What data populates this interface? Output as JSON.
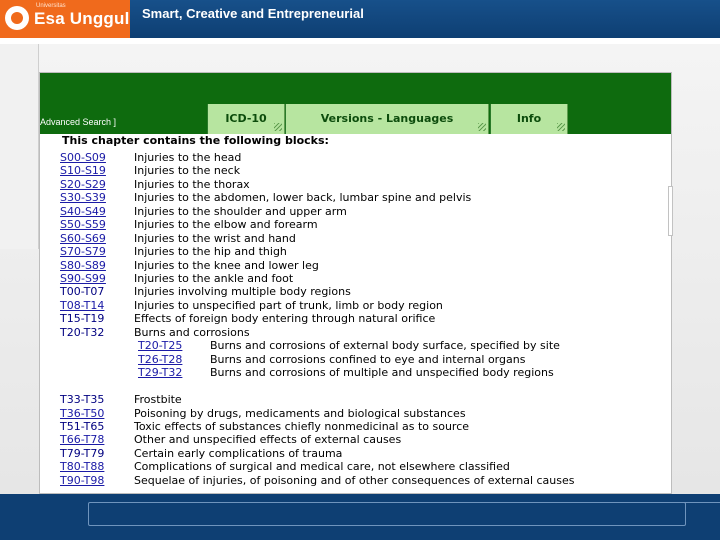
{
  "slide": {
    "logo_university_label": "Universitas",
    "logo_name": "Esa Unggul",
    "tagline": "Smart, Creative and Entrepreneurial"
  },
  "browser": {
    "advanced_search_label": "Advanced Search ]",
    "tabs": [
      {
        "label": "ICD-10"
      },
      {
        "label": "Versions - Languages"
      },
      {
        "label": "Info"
      }
    ]
  },
  "chapter": {
    "intro": "This chapter contains the following blocks:",
    "blocks": [
      {
        "code": "S00-S09",
        "title": "Injuries to the head",
        "link": true
      },
      {
        "code": "S10-S19",
        "title": "Injuries to the neck",
        "link": true
      },
      {
        "code": "S20-S29",
        "title": "Injuries to the thorax",
        "link": true
      },
      {
        "code": "S30-S39",
        "title": "Injuries to the abdomen, lower back, lumbar spine and pelvis",
        "link": true
      },
      {
        "code": "S40-S49",
        "title": "Injuries to the shoulder and upper arm",
        "link": true
      },
      {
        "code": "S50-S59",
        "title": "Injuries to the elbow and forearm",
        "link": true
      },
      {
        "code": "S60-S69",
        "title": "Injuries to the wrist and hand",
        "link": true
      },
      {
        "code": "S70-S79",
        "title": "Injuries to the hip and thigh",
        "link": true
      },
      {
        "code": "S80-S89",
        "title": "Injuries to the knee and lower leg",
        "link": true
      },
      {
        "code": "S90-S99",
        "title": "Injuries to the ankle and foot",
        "link": true
      },
      {
        "code": "T00-T07",
        "title": "Injuries involving multiple body regions",
        "link": false
      },
      {
        "code": "T08-T14",
        "title": "Injuries to unspecified part of trunk, limb or body region",
        "link": true
      },
      {
        "code": "T15-T19",
        "title": "Effects of foreign body entering through natural orifice",
        "link": false
      },
      {
        "code": "T20-T32",
        "title": "Burns and corrosions",
        "link": false
      },
      {
        "code": "T20-T25",
        "title": "Burns and corrosions of external body surface, specified by site",
        "link": true,
        "sub": true
      },
      {
        "code": "T26-T28",
        "title": "Burns and corrosions confined to eye and internal organs",
        "link": true,
        "sub": true
      },
      {
        "code": "T29-T32",
        "title": "Burns and corrosions of multiple and unspecified body regions",
        "link": true,
        "sub": true
      },
      {
        "code": "T33-T35",
        "title": "Frostbite",
        "link": false,
        "gap_before": true
      },
      {
        "code": "T36-T50",
        "title": "Poisoning by drugs, medicaments and biological substances",
        "link": true
      },
      {
        "code": "T51-T65",
        "title": "Toxic effects of substances chiefly nonmedicinal as to source",
        "link": false
      },
      {
        "code": "T66-T78",
        "title": "Other and unspecified effects of external causes",
        "link": true
      },
      {
        "code": "T79-T79",
        "title": "Certain early complications of trauma",
        "link": false
      },
      {
        "code": "T80-T88",
        "title": "Complications of surgical and medical care, not elsewhere classified",
        "link": true
      },
      {
        "code": "T90-T98",
        "title": "Sequelae of injuries, of poisoning and of other consequences of external causes",
        "link": true
      }
    ]
  },
  "colors": {
    "header_blue": "#0e3f73",
    "logo_orange": "#f06a1c",
    "who_green": "#0e6b0e",
    "tab_green": "#b7e5a0",
    "link_blue": "#1a1aa6"
  }
}
